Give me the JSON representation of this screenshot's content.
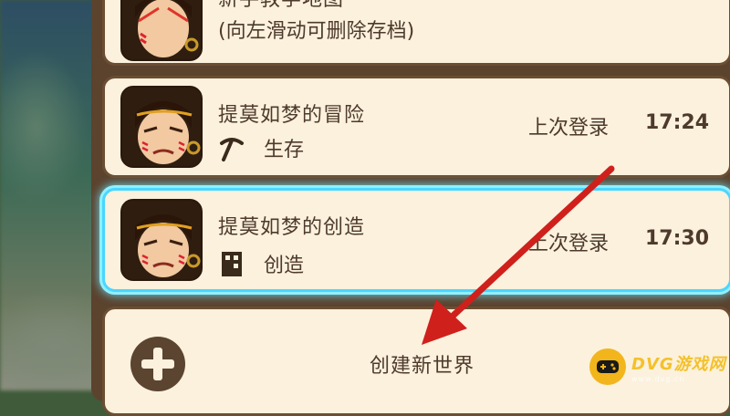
{
  "worlds": [
    {
      "title": "新手教学地图",
      "subtitle": "(向左滑动可删除存档)"
    },
    {
      "title": "提莫如梦的冒险",
      "mode_icon": "pickaxe-icon",
      "mode": "生存",
      "last_login_label": "上次登录",
      "last_login_time": "17:24"
    },
    {
      "title": "提莫如梦的创造",
      "mode_icon": "door-block-icon",
      "mode": "创造",
      "last_login_label": "上次登录",
      "last_login_time": "17:30",
      "selected": true
    }
  ],
  "create_world": {
    "label": "创建新世界",
    "icon": "plus-circle-icon"
  },
  "annotation": {
    "icon": "red-arrow-icon",
    "color": "#d0201c"
  },
  "watermark": {
    "brand": "DVG游戏网",
    "url": "www.dvg.cn"
  },
  "colors": {
    "card_bg": "#fbf1dd",
    "card_border": "#6b4e33",
    "selected_glow": "#4ad6ff",
    "text": "#4e3a2b"
  }
}
